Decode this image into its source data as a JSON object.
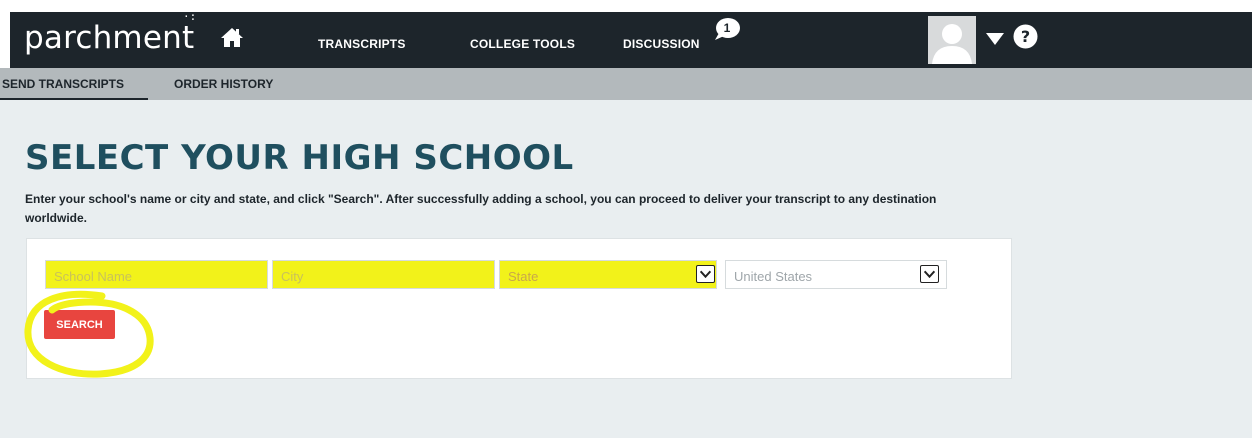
{
  "header": {
    "logo": "parchment",
    "nav": [
      "TRANSCRIPTS",
      "COLLEGE TOOLS",
      "DISCUSSION"
    ],
    "notification_count": "1",
    "icons": [
      "home-icon",
      "chat-bubble-icon",
      "avatar",
      "chevron-down-icon",
      "help-icon"
    ]
  },
  "subnav": {
    "items": [
      "SEND TRANSCRIPTS",
      "ORDER HISTORY"
    ],
    "active": "SEND TRANSCRIPTS"
  },
  "main": {
    "title": "SELECT YOUR HIGH SCHOOL",
    "instructions": "Enter your school's name or city and state, and click \"Search\". After successfully adding a school, you can proceed to deliver your transcript to any destination worldwide.",
    "form": {
      "school_placeholder": "School Name",
      "city_placeholder": "City",
      "state_value": "State",
      "country_value": "United States",
      "search_label": "SEARCH"
    }
  },
  "annotations": {
    "highlight_color": "#f2f21a"
  }
}
